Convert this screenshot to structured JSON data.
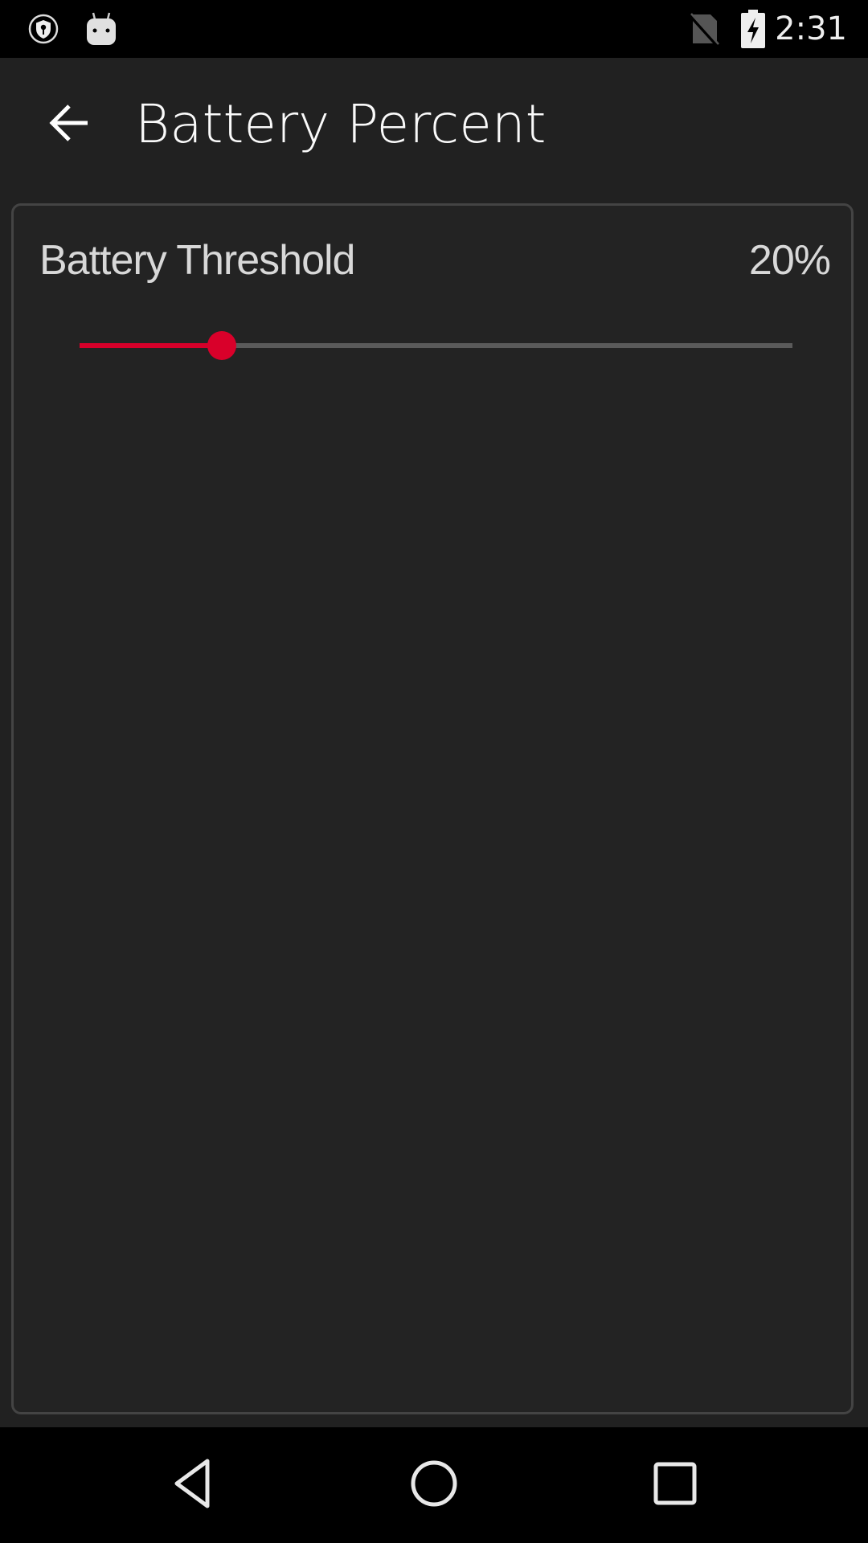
{
  "status_bar": {
    "left_icons": [
      "vpn-shield-key-icon",
      "android-notification-icon"
    ],
    "right_icons": [
      "no-sim-icon",
      "battery-charging-icon"
    ],
    "time": "2:31"
  },
  "toolbar": {
    "back_icon": "arrow-back-icon",
    "title": "Battery Percent"
  },
  "settings": {
    "battery_threshold": {
      "label": "Battery Threshold",
      "value_text": "20%",
      "value_percent": 20,
      "min": 0,
      "max": 100
    }
  },
  "colors": {
    "accent": "#d9002a",
    "background": "#212121",
    "track": "#5a5a5a"
  },
  "nav_bar": {
    "buttons": [
      "back-triangle-icon",
      "home-circle-icon",
      "recents-square-icon"
    ]
  }
}
